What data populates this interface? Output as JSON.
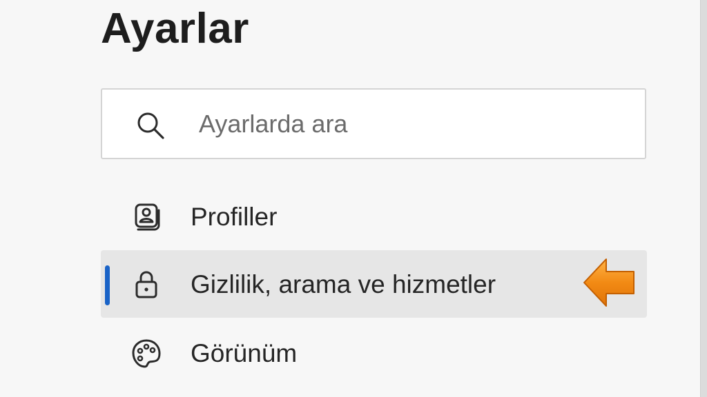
{
  "header": {
    "title": "Ayarlar"
  },
  "search": {
    "placeholder": "Ayarlarda ara",
    "value": ""
  },
  "sidebar": {
    "items": [
      {
        "label": "Profiller",
        "icon": "profile-icon",
        "active": false
      },
      {
        "label": "Gizlilik, arama ve hizmetler",
        "icon": "lock-icon",
        "active": true
      },
      {
        "label": "Görünüm",
        "icon": "palette-icon",
        "active": false
      }
    ]
  },
  "colors": {
    "accent": "#1a63c7",
    "active_bg": "#e6e6e6",
    "arrow": "#f08a12"
  }
}
